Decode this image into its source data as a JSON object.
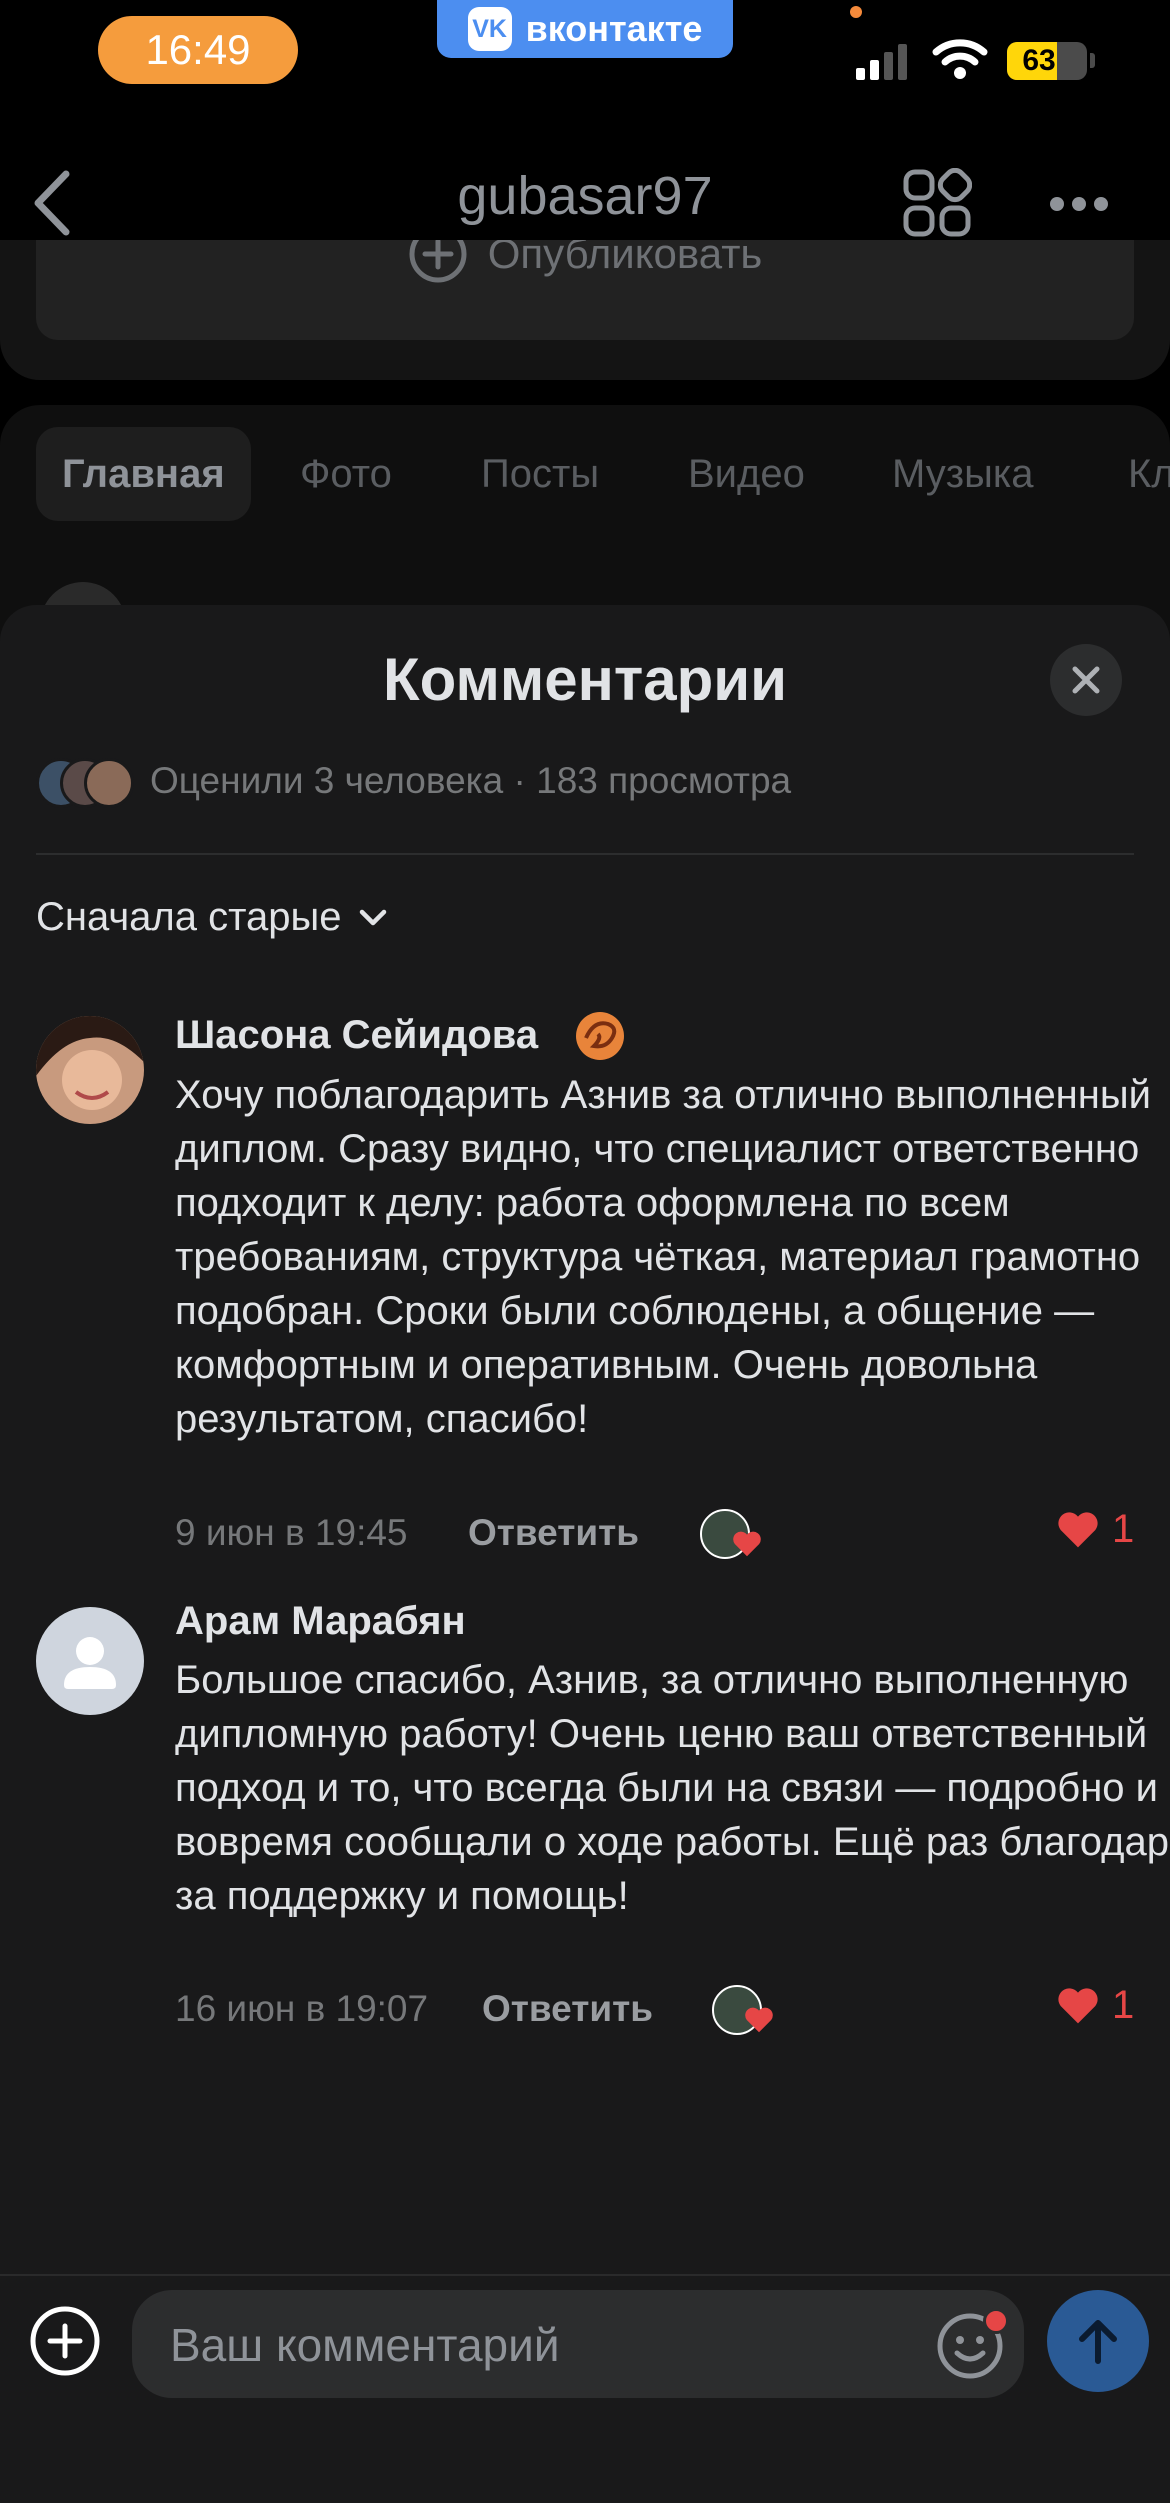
{
  "status_bar": {
    "time": "16:49",
    "app_banner": "вконтакте",
    "battery": "63",
    "battery_level": 0.63
  },
  "header": {
    "title": "gubasar97",
    "back_icon": "chevron-left-icon",
    "grid_icon": "apps-grid-icon",
    "more_icon": "more-horizontal-icon"
  },
  "publish": {
    "label": "Опубликовать"
  },
  "tabs": [
    {
      "label": "Главная",
      "active": true
    },
    {
      "label": "Фото",
      "active": false
    },
    {
      "label": "Посты",
      "active": false
    },
    {
      "label": "Видео",
      "active": false
    },
    {
      "label": "Музыка",
      "active": false
    },
    {
      "label": "Кл",
      "active": false
    }
  ],
  "sheet": {
    "title": "Комментарии",
    "meta": "Оценили 3 человека · 183 просмотра",
    "sort_label": "Сначала старые"
  },
  "comments": [
    {
      "author": "Шасона Сейидова",
      "text": "Хочу поблагодарить Азнив за отлично выполненный диплом. Сразу видно, что специалист ответственно подходит к делу: работа оформлена по всем требованиям, структура чёткая, материал грамотно подобран. Сроки были соблюдены, а общение — комфортным и оперативным. Очень довольна результатом, спасибо!",
      "date": "9 июн в 19:45",
      "reply_label": "Ответить",
      "likes": "1"
    },
    {
      "author": "Арам Марабян",
      "text": "Большое спасибо, Азнив, за отлично выполненную дипломную работу! Очень ценю ваш ответственный подход и то, что всегда были на связи — подробно и вовремя сообщали о ходе работы. Ещё раз благодарю за поддержку и помощь!",
      "date": "16 июн в 19:07",
      "reply_label": "Ответить",
      "likes": "1"
    }
  ],
  "composer": {
    "placeholder": "Ваш комментарий"
  },
  "colors": {
    "accent": "#4c8ef0",
    "like_red": "#e64646",
    "sheet_bg": "#19191a",
    "send_button": "#2a5a95"
  }
}
